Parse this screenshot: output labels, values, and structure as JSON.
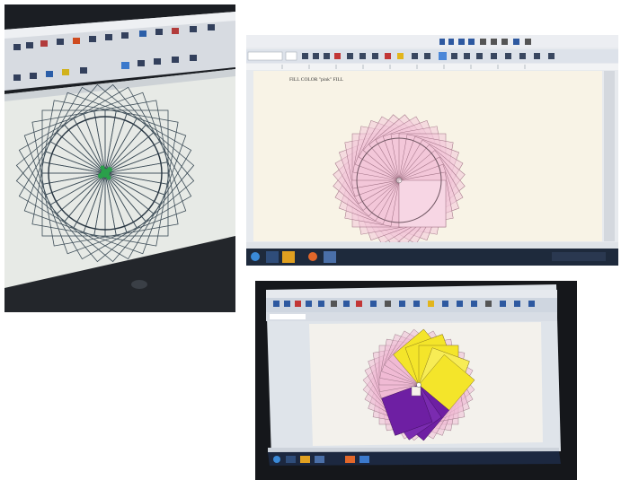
{
  "photos": [
    {
      "id": "left",
      "subject": "monitor photographed at an angle showing a spiral of rotated squares",
      "colors": {
        "stroke": "#3d4d58",
        "center": "#2aa04a",
        "page": "#e7eae6",
        "desk": "#1b1e23"
      }
    },
    {
      "id": "right",
      "subject": "word processor window with pink rotated-square rosette",
      "document_text": "FILL COLOR \"pink\" FILL",
      "colors": {
        "fill": "#f2c6d8",
        "stroke": "#9c6d80",
        "page": "#f8f3e6",
        "toolbar": "#dde2ea",
        "taskbar": "#1e2a3c"
      }
    },
    {
      "id": "bottom",
      "subject": "tablet screen with rosette filled pink, yellow and purple",
      "colors": {
        "pink": "#f0b9d3",
        "yellow": "#f4e52a",
        "purple": "#6e1fa3",
        "page": "#f3f1ec",
        "toolbar": "#cfd6e0",
        "bezel": "#15171b"
      }
    }
  ]
}
